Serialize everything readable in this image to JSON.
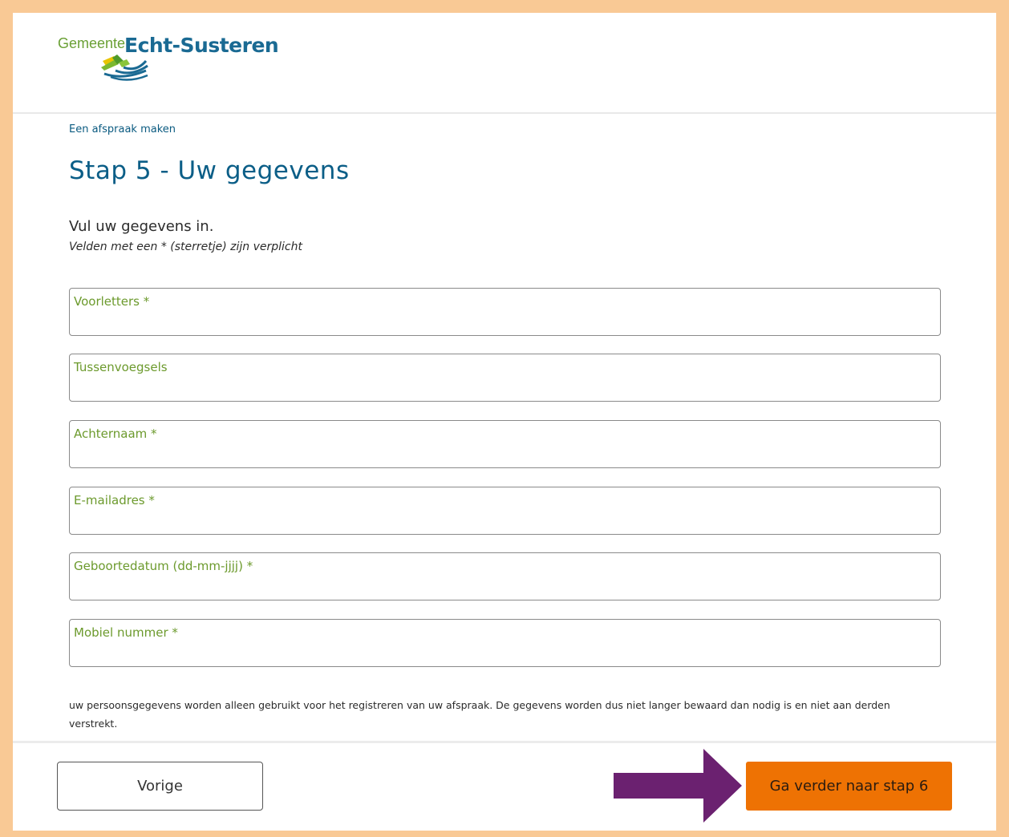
{
  "header": {
    "logo_prefix": "Gemeente",
    "logo_name": "Echt-Susteren"
  },
  "breadcrumb": "Een afspraak maken",
  "title": "Stap 5 - Uw gegevens",
  "intro": "Vul uw gegevens in.",
  "required_note": "Velden met een * (sterretje) zijn verplicht",
  "fields": [
    {
      "label": "Voorletters *",
      "value": ""
    },
    {
      "label": "Tussenvoegsels",
      "value": ""
    },
    {
      "label": "Achternaam *",
      "value": ""
    },
    {
      "label": "E-mailadres *",
      "value": ""
    },
    {
      "label": "Geboortedatum (dd-mm-jjjj) *",
      "value": ""
    },
    {
      "label": "Mobiel nummer *",
      "value": ""
    }
  ],
  "privacy_text": "uw persoonsgegevens worden alleen gebruikt voor het registreren van uw afspraak. De gegevens worden dus niet langer bewaard dan nodig is en niet aan derden verstrekt.",
  "buttons": {
    "previous": "Vorige",
    "next": "Ga verder naar stap 6"
  },
  "colors": {
    "frame": "#f9c995",
    "title": "#0b5e87",
    "label": "#6c9a2d",
    "next_button": "#ee7203",
    "arrow": "#6b2170"
  }
}
